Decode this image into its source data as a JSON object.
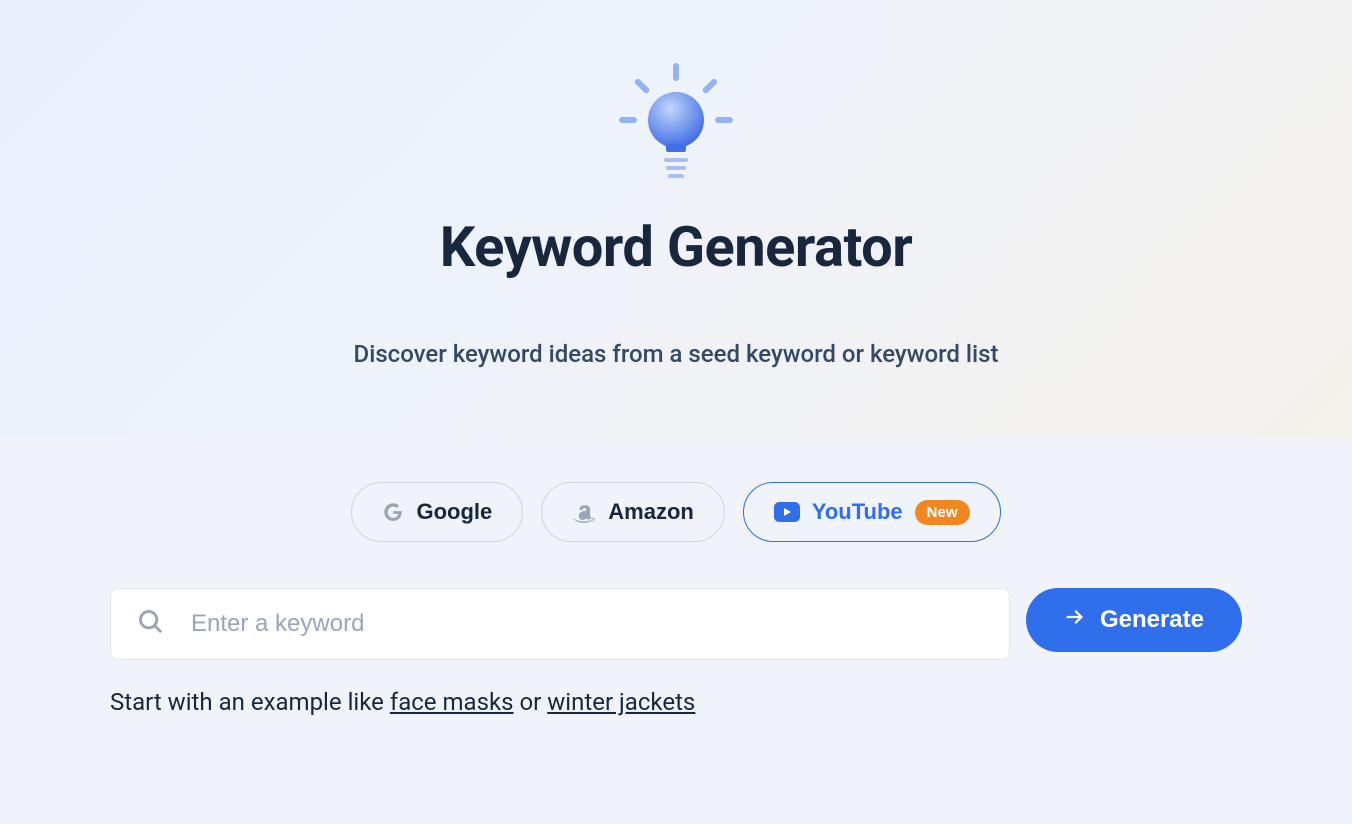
{
  "hero": {
    "title": "Keyword Generator",
    "subtitle": "Discover keyword ideas from a seed keyword or keyword list"
  },
  "tabs": {
    "google": "Google",
    "amazon": "Amazon",
    "youtube": "YouTube",
    "youtube_badge": "New"
  },
  "search": {
    "placeholder": "Enter a keyword",
    "button": "Generate"
  },
  "examples": {
    "prefix": "Start with an example like ",
    "link1": "face masks",
    "separator": " or ",
    "link2": "winter jackets"
  }
}
